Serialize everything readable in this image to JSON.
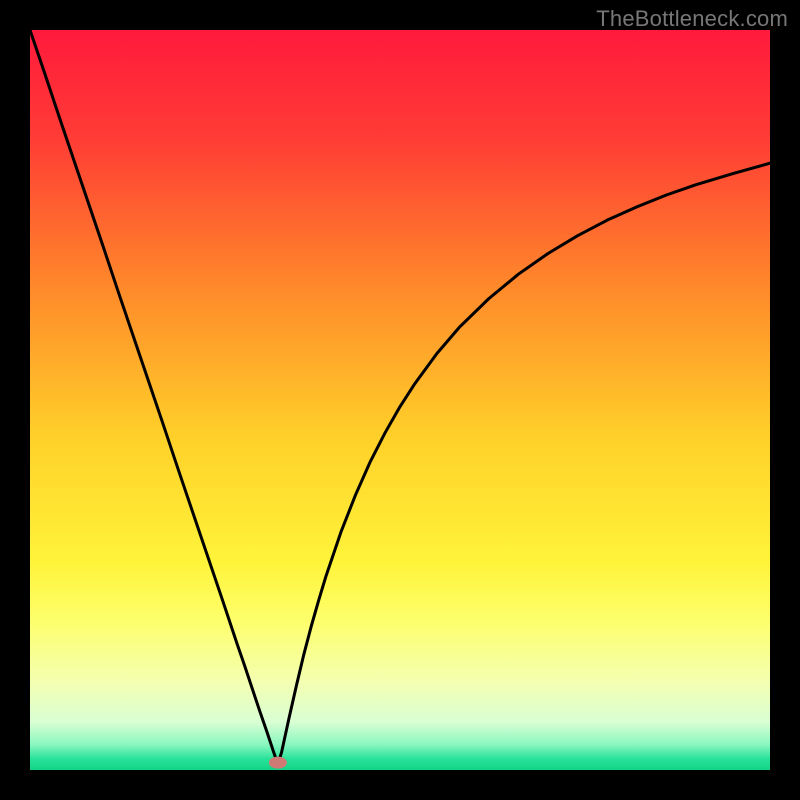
{
  "watermark": "TheBottleneck.com",
  "chart_data": {
    "type": "line",
    "title": "",
    "xlabel": "",
    "ylabel": "",
    "xlim": [
      0,
      100
    ],
    "ylim": [
      0,
      100
    ],
    "grid": false,
    "legend": false,
    "gradient_stops": [
      {
        "offset": 0.0,
        "color": "#ff1a3c"
      },
      {
        "offset": 0.15,
        "color": "#ff3d35"
      },
      {
        "offset": 0.35,
        "color": "#ff8a2a"
      },
      {
        "offset": 0.55,
        "color": "#ffd029"
      },
      {
        "offset": 0.72,
        "color": "#fff43a"
      },
      {
        "offset": 0.8,
        "color": "#fdff6d"
      },
      {
        "offset": 0.88,
        "color": "#f4ffb0"
      },
      {
        "offset": 0.935,
        "color": "#d9ffd4"
      },
      {
        "offset": 0.965,
        "color": "#8cf7c0"
      },
      {
        "offset": 0.985,
        "color": "#28e29a"
      },
      {
        "offset": 1.0,
        "color": "#13d486"
      }
    ],
    "minimum_marker": {
      "x": 33.5,
      "y": 1.0,
      "color": "#cf7a74"
    },
    "series": [
      {
        "name": "curve",
        "color": "#000000",
        "x": [
          0,
          2,
          4,
          6,
          8,
          10,
          12,
          14,
          16,
          18,
          20,
          22,
          24,
          26,
          28,
          29,
          30,
          31,
          32,
          32.5,
          33,
          33.5,
          34,
          35,
          36,
          37,
          38,
          39,
          40,
          42,
          44,
          46,
          48,
          50,
          52,
          55,
          58,
          62,
          66,
          70,
          74,
          78,
          82,
          86,
          90,
          95,
          100
        ],
        "y": [
          100,
          94.1,
          88.1,
          82.2,
          76.3,
          70.4,
          64.4,
          58.5,
          52.6,
          46.7,
          40.7,
          34.8,
          28.9,
          23.0,
          17.0,
          14.1,
          11.1,
          8.1,
          5.2,
          3.7,
          2.2,
          0.8,
          2.4,
          7.0,
          11.4,
          15.6,
          19.4,
          22.9,
          26.2,
          32.1,
          37.2,
          41.7,
          45.6,
          49.1,
          52.2,
          56.3,
          59.8,
          63.7,
          67.0,
          69.8,
          72.2,
          74.3,
          76.1,
          77.7,
          79.1,
          80.6,
          82.0
        ]
      }
    ]
  }
}
